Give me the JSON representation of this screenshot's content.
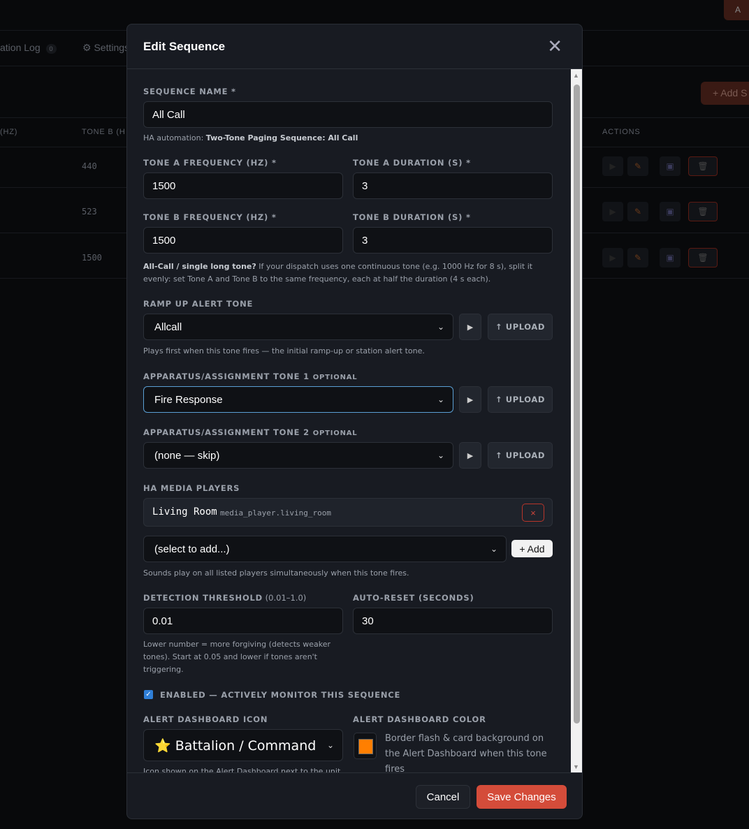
{
  "background": {
    "top_button": "A",
    "tabs": [
      {
        "label": "ation Log",
        "badge": "0"
      },
      {
        "label": "Settings"
      }
    ],
    "add_button": "+ Add S",
    "columns": [
      "(HZ)",
      "TONE B (H",
      "ACTIONS"
    ],
    "rows": [
      {
        "tone_b": "440"
      },
      {
        "tone_b": "523"
      },
      {
        "tone_b": "1500"
      }
    ]
  },
  "modal": {
    "title": "Edit Sequence",
    "close_label": "✕",
    "sequence_name": {
      "label": "SEQUENCE NAME *",
      "value": "All Call"
    },
    "ha_automation": {
      "prefix": "HA automation: ",
      "name": "Two-Tone Paging Sequence: All Call"
    },
    "tone_a_freq": {
      "label": "TONE A FREQUENCY (HZ) *",
      "value": "1500"
    },
    "tone_a_dur": {
      "label": "TONE A DURATION (S) *",
      "value": "3"
    },
    "tone_b_freq": {
      "label": "TONE B FREQUENCY (HZ) *",
      "value": "1500"
    },
    "tone_b_dur": {
      "label": "TONE B DURATION (S) *",
      "value": "3"
    },
    "allcall_help": {
      "bold": "All-Call / single long tone?",
      "text": " If your dispatch uses one continuous tone (e.g. 1000 Hz for 8 s), split it evenly: set Tone A and Tone B to the same frequency, each at half the duration (4 s each)."
    },
    "ramp": {
      "label": "RAMP UP ALERT TONE",
      "value": "Allcall",
      "help": "Plays first when this tone fires — the initial ramp-up or station alert tone."
    },
    "app1": {
      "label": "APPARATUS/ASSIGNMENT TONE 1",
      "optional": "OPTIONAL",
      "value": "Fire Response"
    },
    "app2": {
      "label": "APPARATUS/ASSIGNMENT TONE 2",
      "optional": "OPTIONAL",
      "value": "(none — skip)"
    },
    "upload_label": "↑ UPLOAD",
    "play_icon": "▶",
    "media": {
      "label": "HA MEDIA PLAYERS",
      "players": [
        {
          "name": "Living Room",
          "entity": "media_player.living_room"
        }
      ],
      "remove_label": "×",
      "add_select": "(select to add...)",
      "add_button": "+ Add",
      "help": "Sounds play on all listed players simultaneously when this tone fires."
    },
    "threshold": {
      "label": "DETECTION THRESHOLD",
      "range": " (0.01–1.0)",
      "value": "0.01",
      "help": "Lower number = more forgiving (detects weaker tones). Start at 0.05 and lower if tones aren't triggering."
    },
    "autoreset": {
      "label": "AUTO-RESET (SECONDS)",
      "value": "30"
    },
    "enabled": {
      "label": "ENABLED — ACTIVELY MONITOR THIS SEQUENCE",
      "checked": true
    },
    "icon": {
      "label": "ALERT DASHBOARD ICON",
      "emoji": "⭐",
      "value": "Battalion / Command",
      "help": "Icon shown on the Alert Dashboard next to the unit"
    },
    "color": {
      "label": "ALERT DASHBOARD COLOR",
      "value": "#ff7f00",
      "help": "Border flash & card background on the Alert Dashboard when this tone fires"
    },
    "cancel": "Cancel",
    "save": "Save Changes"
  }
}
